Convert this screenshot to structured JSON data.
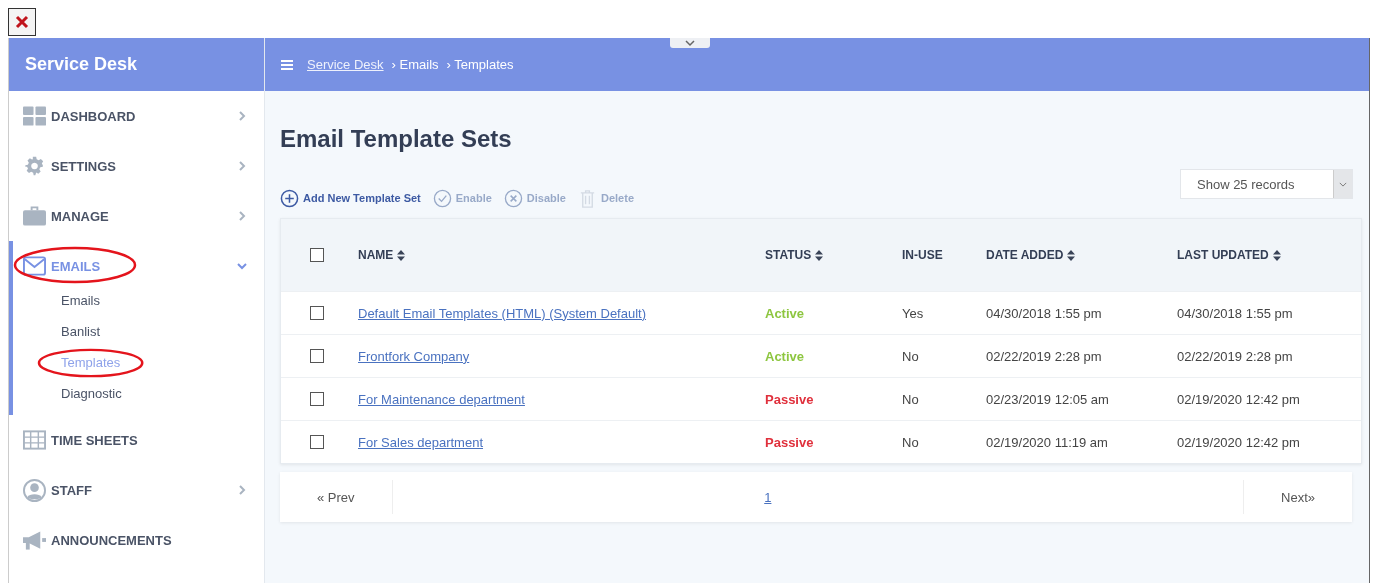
{
  "app_title": "Service Desk",
  "breadcrumb": [
    {
      "label": "Service Desk",
      "link": true
    },
    {
      "label": "› Emails",
      "link": false
    },
    {
      "label": "› Templates",
      "link": false
    }
  ],
  "sidebar": {
    "items": [
      {
        "label": "DASHBOARD",
        "expanded": false,
        "selected": false,
        "circled": false
      },
      {
        "label": "SETTINGS",
        "expanded": false,
        "selected": false,
        "circled": false
      },
      {
        "label": "MANAGE",
        "expanded": false,
        "selected": false,
        "circled": false
      },
      {
        "label": "EMAILS",
        "expanded": true,
        "selected": true,
        "circled": true,
        "children": [
          {
            "label": "Emails",
            "selected": false,
            "circled": false
          },
          {
            "label": "Banlist",
            "selected": false,
            "circled": false
          },
          {
            "label": "Templates",
            "selected": true,
            "circled": true
          },
          {
            "label": "Diagnostic",
            "selected": false,
            "circled": false
          }
        ]
      },
      {
        "label": "TIME SHEETS",
        "selected": false,
        "circled": false
      },
      {
        "label": "STAFF",
        "expanded": false,
        "selected": false,
        "circled": false
      },
      {
        "label": "ANNOUNCEMENTS",
        "selected": false,
        "circled": false
      }
    ]
  },
  "page_title": "Email Template Sets",
  "toolbar": [
    {
      "label": "Add New Template Set",
      "disabled": false
    },
    {
      "label": "Enable",
      "disabled": true
    },
    {
      "label": "Disable",
      "disabled": true
    },
    {
      "label": "Delete",
      "disabled": true
    }
  ],
  "records_select": {
    "value": "Show 25 records"
  },
  "table": {
    "select_all_checked": false,
    "columns": [
      {
        "label": "NAME",
        "sortable": true
      },
      {
        "label": "STATUS",
        "sortable": true
      },
      {
        "label": "IN-USE",
        "sortable": false
      },
      {
        "label": "DATE ADDED",
        "sortable": true
      },
      {
        "label": "LAST UPDATED",
        "sortable": true
      }
    ],
    "rows": [
      {
        "checked": false,
        "name": "Default Email Templates (HTML) (System Default)",
        "status": "Active",
        "color": "#8dc63f",
        "in_use": "Yes",
        "date_added": "04/30/2018 1:55 pm",
        "last_updated": "04/30/2018 1:55 pm"
      },
      {
        "checked": false,
        "name": "Frontfork Company",
        "status": "Active",
        "color": "#8dc63f",
        "in_use": "No",
        "date_added": "02/22/2019 2:28 pm",
        "last_updated": "02/22/2019 2:28 pm"
      },
      {
        "checked": false,
        "name": "For Maintenance department",
        "status": "Passive",
        "color": "#e0303c",
        "in_use": "No",
        "date_added": "02/23/2019 12:05 am",
        "last_updated": "02/19/2020 12:42 pm"
      },
      {
        "checked": false,
        "name": "For Sales department",
        "status": "Passive",
        "color": "#e0303c",
        "in_use": "No",
        "date_added": "02/19/2020 11:19 am",
        "last_updated": "02/19/2020 12:42 pm"
      }
    ]
  },
  "pagination": {
    "prev": "« Prev",
    "pages": [
      {
        "label": "1",
        "selected": true
      }
    ],
    "next": "Next»"
  }
}
